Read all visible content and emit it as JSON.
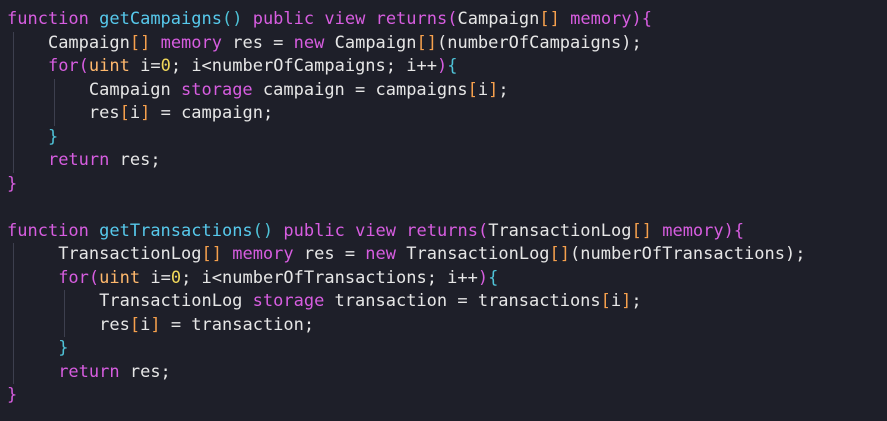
{
  "editor": {
    "theme": {
      "background": "#1e1f29",
      "keyword": "#d75de0",
      "function": "#57c9ec",
      "bracket": "#f6a04d",
      "brace_inner": "#4fc3d8",
      "number": "#f0d75a",
      "text": "#e6e6e6"
    },
    "lines": [
      [
        {
          "t": "function",
          "c": "kw"
        },
        {
          "t": " ",
          "c": "pl"
        },
        {
          "t": "getCampaigns",
          "c": "fn"
        },
        {
          "t": "()",
          "c": "bc"
        },
        {
          "t": " ",
          "c": "pl"
        },
        {
          "t": "public",
          "c": "kw"
        },
        {
          "t": " ",
          "c": "pl"
        },
        {
          "t": "view",
          "c": "kw"
        },
        {
          "t": " ",
          "c": "pl"
        },
        {
          "t": "returns",
          "c": "kw"
        },
        {
          "t": "(",
          "c": "kw"
        },
        {
          "t": "Campaign",
          "c": "pl"
        },
        {
          "t": "[]",
          "c": "br"
        },
        {
          "t": " ",
          "c": "pl"
        },
        {
          "t": "memory",
          "c": "kw"
        },
        {
          "t": ")",
          "c": "kw"
        },
        {
          "t": "{",
          "c": "kw"
        }
      ],
      [
        {
          "t": "    ",
          "c": "pl"
        },
        {
          "t": "Campaign",
          "c": "pl"
        },
        {
          "t": "[]",
          "c": "br"
        },
        {
          "t": " ",
          "c": "pl"
        },
        {
          "t": "memory",
          "c": "kw"
        },
        {
          "t": " res = ",
          "c": "pl"
        },
        {
          "t": "new",
          "c": "kw"
        },
        {
          "t": " Campaign",
          "c": "pl"
        },
        {
          "t": "[]",
          "c": "br"
        },
        {
          "t": "(numberOfCampaigns);",
          "c": "pl"
        }
      ],
      [
        {
          "t": "    ",
          "c": "pl"
        },
        {
          "t": "for",
          "c": "kw"
        },
        {
          "t": "(",
          "c": "kw"
        },
        {
          "t": "uint",
          "c": "ty"
        },
        {
          "t": " i=",
          "c": "pl"
        },
        {
          "t": "0",
          "c": "num"
        },
        {
          "t": "; i<numberOfCampaigns; i++",
          "c": "pl"
        },
        {
          "t": ")",
          "c": "kw"
        },
        {
          "t": "{",
          "c": "bc"
        }
      ],
      [
        {
          "t": "        ",
          "c": "pl"
        },
        {
          "t": "Campaign ",
          "c": "pl"
        },
        {
          "t": "storage",
          "c": "kw"
        },
        {
          "t": " campaign = campaigns",
          "c": "pl"
        },
        {
          "t": "[",
          "c": "br"
        },
        {
          "t": "i",
          "c": "pl"
        },
        {
          "t": "]",
          "c": "br"
        },
        {
          "t": ";",
          "c": "pl"
        }
      ],
      [
        {
          "t": "        ",
          "c": "pl"
        },
        {
          "t": "res",
          "c": "pl"
        },
        {
          "t": "[",
          "c": "br"
        },
        {
          "t": "i",
          "c": "pl"
        },
        {
          "t": "]",
          "c": "br"
        },
        {
          "t": " = campaign;",
          "c": "pl"
        }
      ],
      [
        {
          "t": "    ",
          "c": "pl"
        },
        {
          "t": "}",
          "c": "bc"
        }
      ],
      [
        {
          "t": "    ",
          "c": "pl"
        },
        {
          "t": "return",
          "c": "kw"
        },
        {
          "t": " res;",
          "c": "pl"
        }
      ],
      [
        {
          "t": "}",
          "c": "kw"
        }
      ],
      [],
      [
        {
          "t": "function",
          "c": "kw"
        },
        {
          "t": " ",
          "c": "pl"
        },
        {
          "t": "getTransactions",
          "c": "fn"
        },
        {
          "t": "()",
          "c": "bc"
        },
        {
          "t": " ",
          "c": "pl"
        },
        {
          "t": "public",
          "c": "kw"
        },
        {
          "t": " ",
          "c": "pl"
        },
        {
          "t": "view",
          "c": "kw"
        },
        {
          "t": " ",
          "c": "pl"
        },
        {
          "t": "returns",
          "c": "kw"
        },
        {
          "t": "(",
          "c": "kw"
        },
        {
          "t": "TransactionLog",
          "c": "pl"
        },
        {
          "t": "[]",
          "c": "br"
        },
        {
          "t": " ",
          "c": "pl"
        },
        {
          "t": "memory",
          "c": "kw"
        },
        {
          "t": ")",
          "c": "kw"
        },
        {
          "t": "{",
          "c": "kw"
        }
      ],
      [
        {
          "t": "     ",
          "c": "pl"
        },
        {
          "t": "TransactionLog",
          "c": "pl"
        },
        {
          "t": "[]",
          "c": "br"
        },
        {
          "t": " ",
          "c": "pl"
        },
        {
          "t": "memory",
          "c": "kw"
        },
        {
          "t": " res = ",
          "c": "pl"
        },
        {
          "t": "new",
          "c": "kw"
        },
        {
          "t": " TransactionLog",
          "c": "pl"
        },
        {
          "t": "[]",
          "c": "br"
        },
        {
          "t": "(numberOfTransactions);",
          "c": "pl"
        }
      ],
      [
        {
          "t": "     ",
          "c": "pl"
        },
        {
          "t": "for",
          "c": "kw"
        },
        {
          "t": "(",
          "c": "kw"
        },
        {
          "t": "uint",
          "c": "ty"
        },
        {
          "t": " i=",
          "c": "pl"
        },
        {
          "t": "0",
          "c": "num"
        },
        {
          "t": "; i<numberOfTransactions; i++",
          "c": "pl"
        },
        {
          "t": ")",
          "c": "kw"
        },
        {
          "t": "{",
          "c": "bc"
        }
      ],
      [
        {
          "t": "         ",
          "c": "pl"
        },
        {
          "t": "TransactionLog ",
          "c": "pl"
        },
        {
          "t": "storage",
          "c": "kw"
        },
        {
          "t": " transaction = transactions",
          "c": "pl"
        },
        {
          "t": "[",
          "c": "br"
        },
        {
          "t": "i",
          "c": "pl"
        },
        {
          "t": "]",
          "c": "br"
        },
        {
          "t": ";",
          "c": "pl"
        }
      ],
      [
        {
          "t": "         ",
          "c": "pl"
        },
        {
          "t": "res",
          "c": "pl"
        },
        {
          "t": "[",
          "c": "br"
        },
        {
          "t": "i",
          "c": "pl"
        },
        {
          "t": "]",
          "c": "br"
        },
        {
          "t": " = transaction;",
          "c": "pl"
        }
      ],
      [
        {
          "t": "     ",
          "c": "pl"
        },
        {
          "t": "}",
          "c": "bc"
        }
      ],
      [
        {
          "t": "     ",
          "c": "pl"
        },
        {
          "t": "return",
          "c": "kw"
        },
        {
          "t": " res;",
          "c": "pl"
        }
      ],
      [
        {
          "t": "}",
          "c": "kw"
        }
      ]
    ]
  }
}
